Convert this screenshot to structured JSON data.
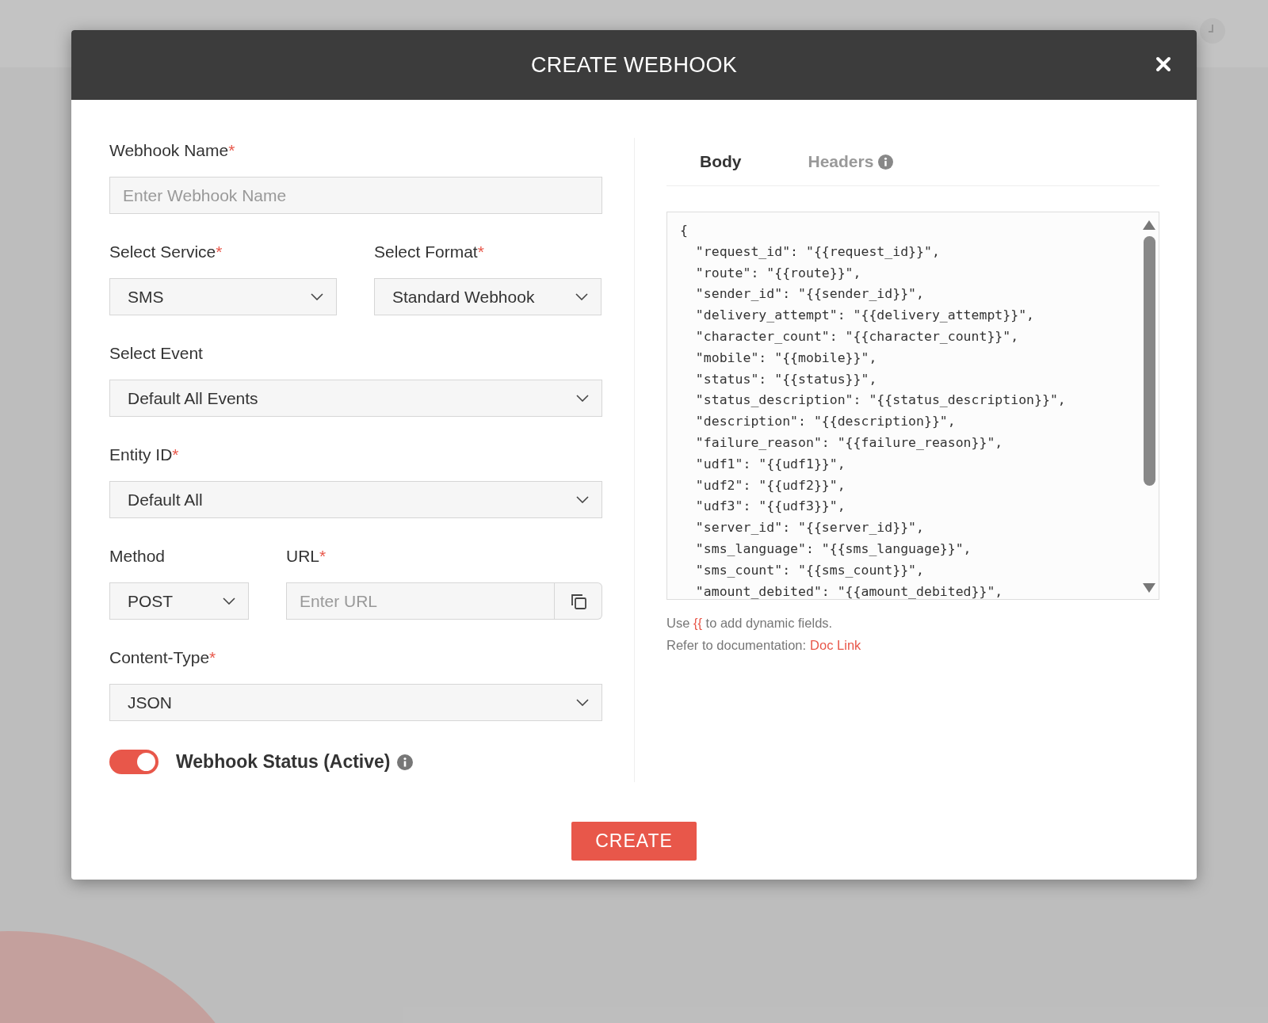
{
  "modal": {
    "title": "CREATE WEBHOOK",
    "rows": [
      [
        {
          "kind": "text",
          "label": "Webhook Name",
          "asterisk": "*",
          "placeholder": "Enter Webhook Name"
        }
      ],
      [
        {
          "kind": "select",
          "label": "Select Service",
          "asterisk": "*",
          "value": "SMS"
        },
        {
          "kind": "select",
          "label": "Select Format",
          "asterisk": "*",
          "value": "Standard Webhook"
        }
      ],
      [
        {
          "kind": "select",
          "label": "Select Event",
          "value": "Default All Events"
        }
      ],
      [
        {
          "kind": "select",
          "label": "Entity ID",
          "asterisk": "*",
          "value": "Default All"
        }
      ],
      [
        {
          "kind": "select",
          "label": "Method",
          "value": "POST"
        },
        {
          "kind": "url",
          "label": "URL",
          "asterisk": "*",
          "placeholder": "Enter URL"
        }
      ],
      [
        {
          "kind": "select",
          "label": "Content-Type",
          "asterisk": "*",
          "value": "JSON"
        }
      ]
    ],
    "status": {
      "label": "Webhook Status (Active)",
      "on": true
    },
    "tabs": [
      {
        "label": "Body",
        "selected": true,
        "info": false
      },
      {
        "label": "Headers",
        "selected": false,
        "info": true
      }
    ],
    "code_lines": [
      "{",
      "  \"request_id\": \"{{request_id}}\",",
      "  \"route\": \"{{route}}\",",
      "  \"sender_id\": \"{{sender_id}}\",",
      "  \"delivery_attempt\": \"{{delivery_attempt}}\",",
      "  \"character_count\": \"{{character_count}}\",",
      "  \"mobile\": \"{{mobile}}\",",
      "  \"status\": \"{{status}}\",",
      "  \"status_description\": \"{{status_description}}\",",
      "  \"description\": \"{{description}}\",",
      "  \"failure_reason\": \"{{failure_reason}}\",",
      "  \"udf1\": \"{{udf1}}\",",
      "  \"udf2\": \"{{udf2}}\",",
      "  \"udf3\": \"{{udf3}}\",",
      "  \"server_id\": \"{{server_id}}\",",
      "  \"sms_language\": \"{{sms_language}}\",",
      "  \"sms_count\": \"{{sms_count}}\",",
      "  \"amount_debited\": \"{{amount_debited}}\","
    ],
    "hint": [
      {
        "text": "Use ",
        "accent": false
      },
      {
        "text": "{{",
        "accent": true
      },
      {
        "text": " to add dynamic fields.",
        "accent": false
      }
    ],
    "doc": {
      "prefix": "Refer to documentation:",
      "link": "Doc Link"
    },
    "create_button": "CREATE"
  }
}
